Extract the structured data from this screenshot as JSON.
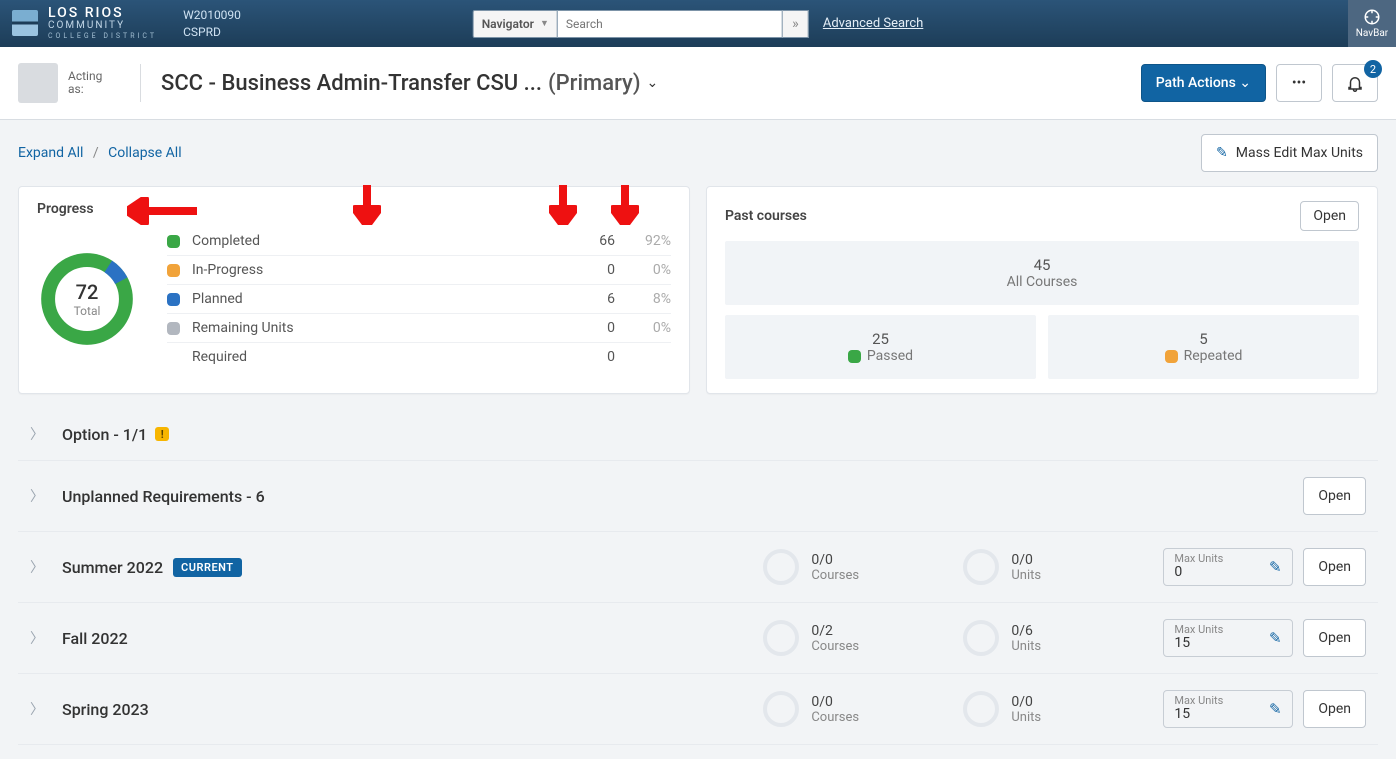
{
  "brand": {
    "line1": "LOS RIOS",
    "line2": "COMMUNITY",
    "line3": "COLLEGE DISTRICT"
  },
  "env": {
    "userId": "W2010090",
    "instance": "CSPRD"
  },
  "navbar": {
    "navigatorLabel": "Navigator",
    "searchPlaceholder": "Search",
    "advSearch": "Advanced Search",
    "navBarLabel": "NavBar"
  },
  "subhead": {
    "actingAs": "Acting as:",
    "pathName": "SCC - Business Admin-Transfer CSU ...",
    "primaryTag": "(Primary)",
    "pathActions": "Path Actions",
    "notifCount": "2"
  },
  "toolrow": {
    "expandAll": "Expand All",
    "collapseAll": "Collapse All",
    "massEdit": "Mass Edit Max Units"
  },
  "progress": {
    "title": "Progress",
    "total": "72",
    "totalLabel": "Total",
    "rows": [
      {
        "color": "#3aa746",
        "label": "Completed",
        "value": "66",
        "pct": "92%"
      },
      {
        "color": "#f1a33a",
        "label": "In-Progress",
        "value": "0",
        "pct": "0%"
      },
      {
        "color": "#2b72c3",
        "label": "Planned",
        "value": "6",
        "pct": "8%"
      },
      {
        "color": "#b2b7bf",
        "label": "Remaining Units",
        "value": "0",
        "pct": "0%"
      },
      {
        "color": "",
        "label": "Required",
        "value": "0",
        "pct": ""
      }
    ]
  },
  "pastCourses": {
    "title": "Past courses",
    "openLabel": "Open",
    "all": {
      "num": "45",
      "label": "All Courses"
    },
    "passed": {
      "num": "25",
      "label": "Passed",
      "color": "#3aa746"
    },
    "repeated": {
      "num": "5",
      "label": "Repeated",
      "color": "#f1a33a"
    }
  },
  "sections": {
    "option": "Option - 1/1",
    "unplanned": "Unplanned Requirements - 6",
    "openLabel": "Open"
  },
  "terms": [
    {
      "name": "Summer 2022",
      "current": true,
      "coursesProg": "0/0",
      "unitsProg": "0/0",
      "maxLabel": "Max Units",
      "max": "0"
    },
    {
      "name": "Fall 2022",
      "current": false,
      "coursesProg": "0/2",
      "unitsProg": "0/6",
      "maxLabel": "Max Units",
      "max": "15"
    },
    {
      "name": "Spring 2023",
      "current": false,
      "coursesProg": "0/0",
      "unitsProg": "0/0",
      "maxLabel": "Max Units",
      "max": "15"
    }
  ],
  "labels": {
    "courses": "Courses",
    "units": "Units",
    "current": "CURRENT",
    "open": "Open"
  }
}
